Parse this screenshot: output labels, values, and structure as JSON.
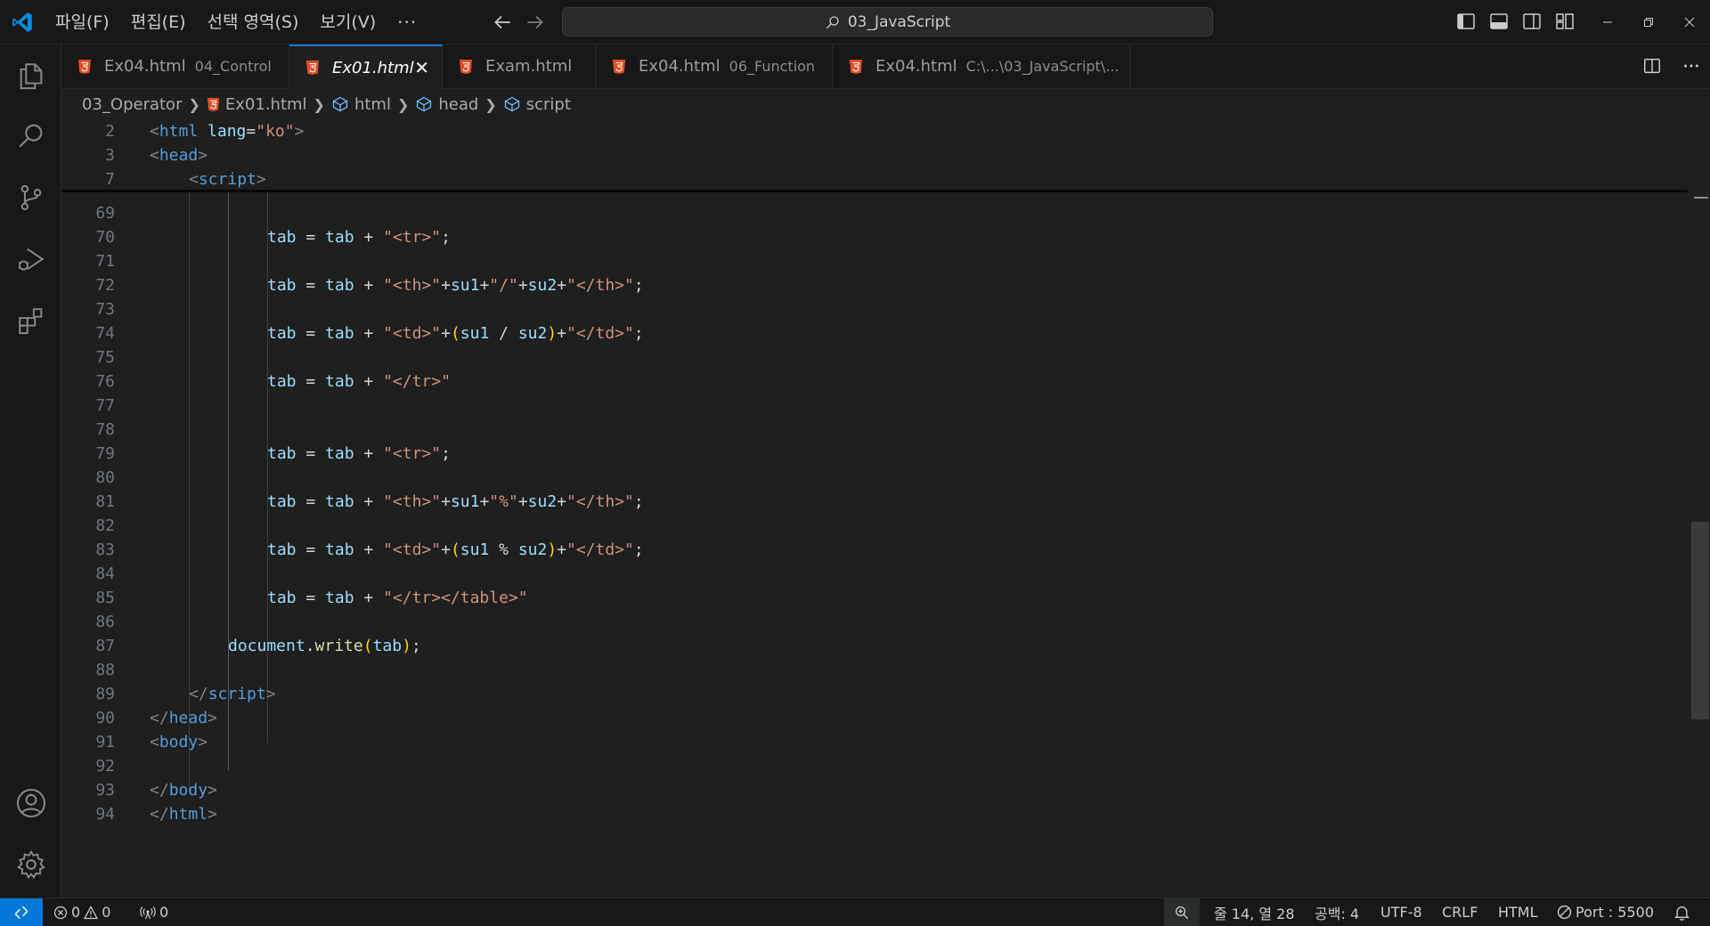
{
  "titlebar": {
    "menu": [
      "파일(F)",
      "편집(E)",
      "선택 영역(S)",
      "보기(V)"
    ],
    "more": "···",
    "search_text": "03_JavaScript"
  },
  "tabs": [
    {
      "name": "Ex04.html",
      "desc": "04_Control",
      "active": false
    },
    {
      "name": "Ex01.html",
      "desc": "",
      "active": true
    },
    {
      "name": "Exam.html",
      "desc": "",
      "active": false
    },
    {
      "name": "Ex04.html",
      "desc": "06_Function",
      "active": false
    },
    {
      "name": "Ex04.html",
      "desc": "C:\\...\\03_JavaScript\\...",
      "active": false
    }
  ],
  "breadcrumb": {
    "folder": "03_Operator",
    "file": "Ex01.html",
    "html": "html",
    "head": "head",
    "script": "script"
  },
  "sticky_lines": [
    {
      "num": "2"
    },
    {
      "num": "3"
    },
    {
      "num": "7"
    }
  ],
  "code_lines": [
    {
      "num": "69"
    },
    {
      "num": "70"
    },
    {
      "num": "71"
    },
    {
      "num": "72"
    },
    {
      "num": "73"
    },
    {
      "num": "74"
    },
    {
      "num": "75"
    },
    {
      "num": "76"
    },
    {
      "num": "77"
    },
    {
      "num": "78"
    },
    {
      "num": "79"
    },
    {
      "num": "80"
    },
    {
      "num": "81"
    },
    {
      "num": "82"
    },
    {
      "num": "83"
    },
    {
      "num": "84"
    },
    {
      "num": "85"
    },
    {
      "num": "86"
    },
    {
      "num": "87"
    },
    {
      "num": "88"
    },
    {
      "num": "89"
    },
    {
      "num": "90"
    },
    {
      "num": "91"
    },
    {
      "num": "92"
    },
    {
      "num": "93"
    },
    {
      "num": "94"
    }
  ],
  "code": {
    "html_tag": "html",
    "lang_attr": "lang",
    "eq": "=",
    "ko": "\"ko\"",
    "head_tag": "head",
    "script_tag": "script",
    "body_tag": "body",
    "lt": "<",
    "gt": ">",
    "lt_slash": "</",
    "tab": "tab",
    "assign": " = ",
    "plus": " + ",
    "semi": ";",
    "s_tr": "\"<tr>\"",
    "s_th": "\"<th>\"",
    "s_td": "\"<td>\"",
    "s_th_close": "\"</th>\"",
    "s_td_close": "\"</td>\"",
    "s_tr_close": "\"</tr>\"",
    "s_tr_table_close": "\"</tr></table>\"",
    "s_slash": "\"/\"",
    "s_percent": "\"%\"",
    "su1": "su1",
    "su2": "su2",
    "plus_tight": "+",
    "div": " / ",
    "mod": " % ",
    "paren_open": "(",
    "paren_close": ")",
    "document": "document",
    "dot": ".",
    "write": "write"
  },
  "statusbar": {
    "errors": "0",
    "warnings": "0",
    "ports": "0",
    "position": "줄 14, 열 28",
    "spaces": "공백: 4",
    "encoding": "UTF-8",
    "eol": "CRLF",
    "language": "HTML",
    "port": "Port : 5500"
  },
  "colors": {
    "accent": "#0078d4",
    "html_icon": "#e44d26",
    "tag": "#569cd6",
    "string": "#ce9178",
    "variable": "#9cdcfe",
    "function": "#dcdcaa",
    "bracket": "#ffd700"
  },
  "icons": [
    "vscode-logo-icon",
    "arrow-left-icon",
    "arrow-right-icon",
    "search-icon",
    "toggle-primary-sidebar-icon",
    "toggle-panel-icon",
    "toggle-secondary-sidebar-icon",
    "customize-layout-icon",
    "minimize-icon",
    "restore-icon",
    "close-icon",
    "explorer-icon",
    "search-view-icon",
    "source-control-icon",
    "run-debug-icon",
    "extensions-icon",
    "account-icon",
    "manage-gear-icon",
    "html-file-icon",
    "split-editor-icon",
    "more-actions-icon",
    "symbol-element-icon",
    "remote-icon",
    "error-icon",
    "warning-icon",
    "broadcast-icon",
    "zoom-icon",
    "port-icon",
    "bell-icon"
  ]
}
